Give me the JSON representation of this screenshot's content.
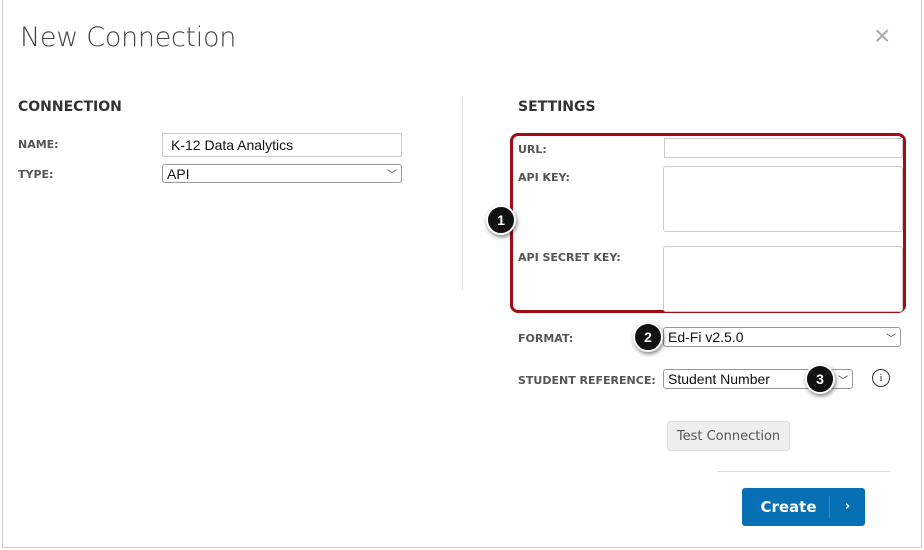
{
  "dialog": {
    "title": "New Connection",
    "close_icon": "×"
  },
  "connection": {
    "heading": "CONNECTION",
    "name_label": "NAME:",
    "name_value": "K-12 Data Analytics",
    "type_label": "TYPE:",
    "type_value": "API"
  },
  "settings": {
    "heading": "SETTINGS",
    "url_label": "URL:",
    "url_value": "",
    "api_key_label": "API KEY:",
    "api_secret_label": "API SECRET KEY:",
    "format_label": "FORMAT:",
    "format_value": "Ed-Fi v2.5.0",
    "student_ref_label": "STUDENT REFERENCE:",
    "student_ref_value": "Student Number",
    "info_icon": "i"
  },
  "callouts": [
    "1",
    "2",
    "3"
  ],
  "buttons": {
    "test": "Test Connection",
    "create": "Create",
    "create_arrow": "›"
  },
  "colors": {
    "highlight": "#a00d12",
    "primary": "#0770b5"
  }
}
